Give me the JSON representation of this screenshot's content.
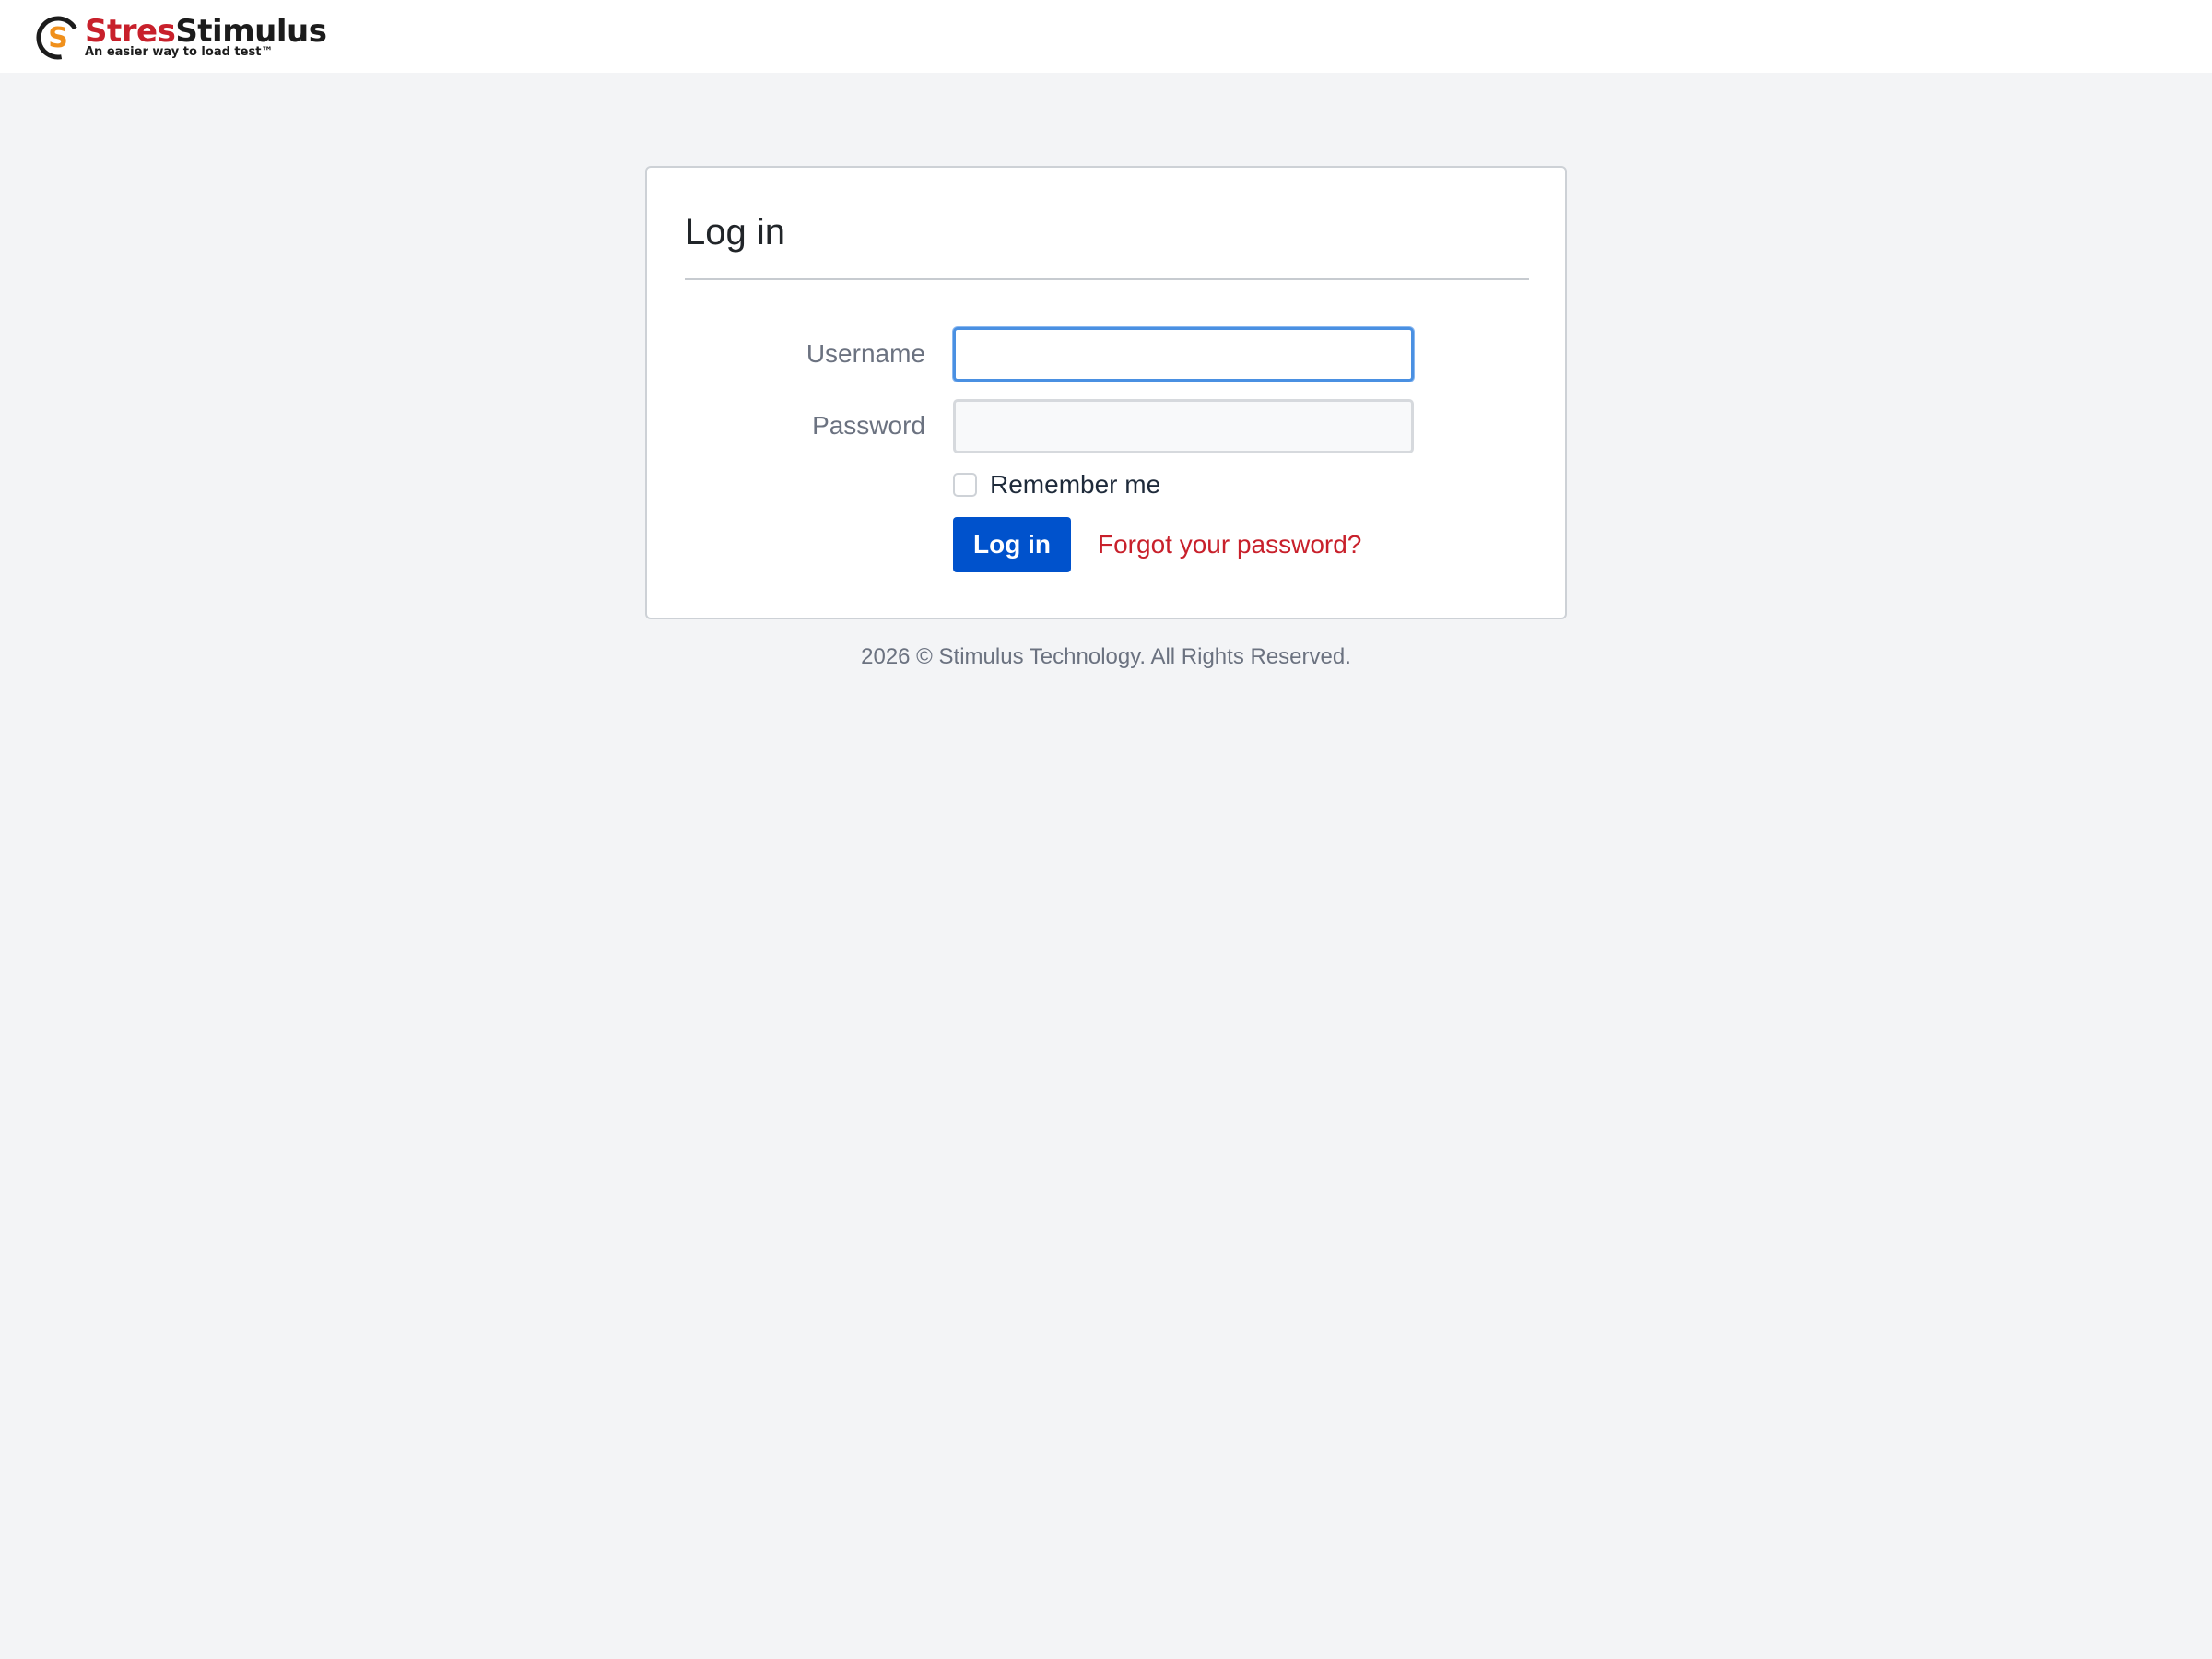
{
  "header": {
    "logo": {
      "word_part1": "Stres",
      "word_part2": "Stimulus",
      "tagline": "An easier way to load test™",
      "colors": {
        "red": "#c8202b",
        "orange": "#f0901c",
        "dark": "#1c1c1c"
      }
    }
  },
  "login_card": {
    "title": "Log in",
    "username": {
      "label": "Username",
      "value": "",
      "placeholder": ""
    },
    "password": {
      "label": "Password",
      "value": "",
      "placeholder": ""
    },
    "remember_me": {
      "label": "Remember me",
      "checked": false
    },
    "submit_label": "Log in",
    "forgot_link": "Forgot your password?"
  },
  "footer": {
    "copyright": "2026 © Stimulus Technology. All Rights Reserved."
  },
  "colors": {
    "accent": "#0052cc",
    "link": "#c8202b",
    "focus": "#4a90e2",
    "page_bg": "#f3f4f6"
  }
}
